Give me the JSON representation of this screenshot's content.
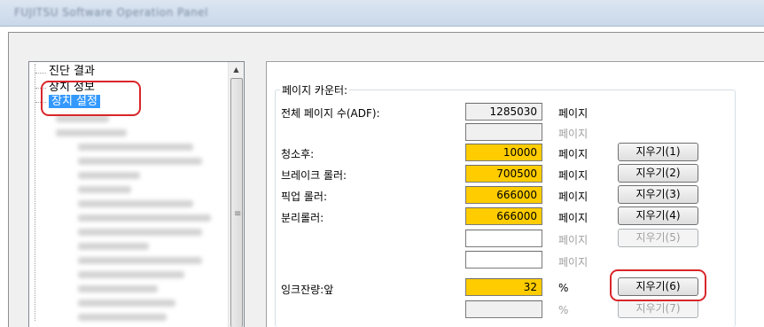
{
  "window": {
    "title": "FUJITSU Software Operation Panel"
  },
  "tree": {
    "items": [
      {
        "label": "진단 결과",
        "selected": false
      },
      {
        "label": "장치 정보",
        "selected": false
      },
      {
        "label": "장치 설정",
        "selected": true
      }
    ]
  },
  "counter_group": {
    "title": "페이지 카운터:",
    "rows": [
      {
        "label": "전체 페이지 수(ADF):",
        "value": "1285030",
        "unit": "페이지",
        "button": ""
      },
      {
        "label": "",
        "value": "",
        "unit": "페이지",
        "button": ""
      },
      {
        "label": "청소후:",
        "value": "10000",
        "unit": "페이지",
        "button": "지우기(1)"
      },
      {
        "label": "브레이크 롤러:",
        "value": "700500",
        "unit": "페이지",
        "button": "지우기(2)"
      },
      {
        "label": "픽업 롤러:",
        "value": "666000",
        "unit": "페이지",
        "button": "지우기(3)"
      },
      {
        "label": "분리롤러:",
        "value": "666000",
        "unit": "페이지",
        "button": "지우기(4)"
      },
      {
        "label": "",
        "value": "",
        "unit": "페이지",
        "button": "지우기(5)"
      },
      {
        "label": "",
        "value": "",
        "unit": "페이지",
        "button": ""
      },
      {
        "label": "잉크잔량:앞",
        "value": "32",
        "unit": "%",
        "button": "지우기(6)"
      },
      {
        "label": "",
        "value": "",
        "unit": "%",
        "button": "지우기(7)"
      }
    ]
  },
  "colors": {
    "highlight": "#ffcc00",
    "selection": "#3399ff",
    "callout": "#d9262a"
  }
}
